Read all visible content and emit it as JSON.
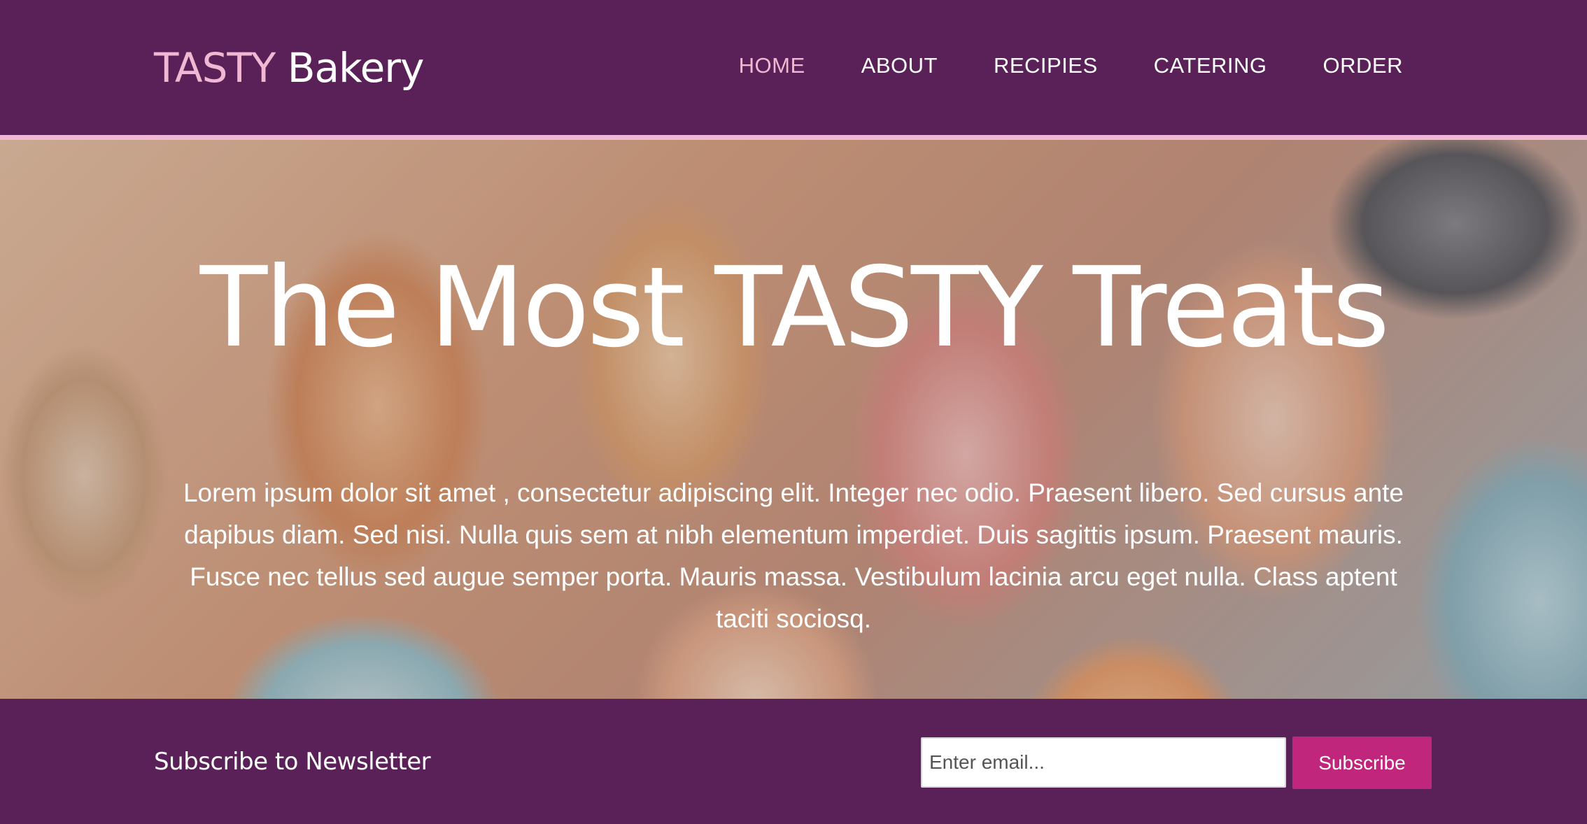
{
  "header": {
    "logo_accent": "TASTY",
    "logo_main": "Bakery",
    "nav": [
      {
        "label": "HOME",
        "active": true
      },
      {
        "label": "ABOUT",
        "active": false
      },
      {
        "label": "RECIPIES",
        "active": false
      },
      {
        "label": "CATERING",
        "active": false
      },
      {
        "label": "ORDER",
        "active": false
      }
    ]
  },
  "hero": {
    "title": "The Most TASTY Treats",
    "text": "Lorem ipsum dolor sit amet , consectetur adipiscing elit. Integer nec odio. Praesent libero. Sed cursus ante dapibus diam. Sed nisi. Nulla quis sem at nibh elementum imperdiet. Duis sagittis ipsum. Praesent mauris. Fusce nec tellus sed augue semper porta. Mauris massa. Vestibulum lacinia arcu eget nulla. Class aptent taciti sociosq."
  },
  "newsletter": {
    "label": "Subscribe to Newsletter",
    "email_placeholder": "Enter email...",
    "email_value": "",
    "button_label": "Subscribe"
  },
  "colors": {
    "brand_purple": "#5a2159",
    "accent_pink": "#f1b8d3",
    "button_magenta": "#c0267b"
  }
}
